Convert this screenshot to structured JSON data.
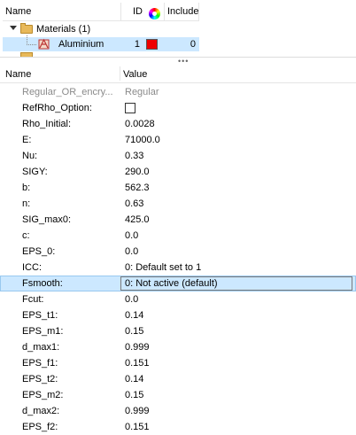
{
  "browser": {
    "columns": {
      "name": "Name",
      "id": "ID",
      "include": "Include"
    },
    "group": {
      "label": "Materials (1)"
    },
    "item": {
      "label": "Aluminium",
      "id": "1",
      "include": "0",
      "color": "#ee0000"
    }
  },
  "editor": {
    "columns": {
      "name": "Name",
      "value": "Value"
    },
    "rows": [
      {
        "name": "Regular_OR_encry...",
        "value": "Regular"
      },
      {
        "name": "RefRho_Option:",
        "value": ""
      },
      {
        "name": "Rho_Initial:",
        "value": "0.0028"
      },
      {
        "name": "E:",
        "value": "71000.0"
      },
      {
        "name": "Nu:",
        "value": "0.33"
      },
      {
        "name": "SIGY:",
        "value": "290.0"
      },
      {
        "name": "b:",
        "value": "562.3"
      },
      {
        "name": "n:",
        "value": "0.63"
      },
      {
        "name": "SIG_max0:",
        "value": "425.0"
      },
      {
        "name": "c:",
        "value": "0.0"
      },
      {
        "name": "EPS_0:",
        "value": "0.0"
      },
      {
        "name": "ICC:",
        "value": "0: Default set to 1"
      },
      {
        "name": "Fsmooth:",
        "value": "0: Not active (default)"
      },
      {
        "name": "Fcut:",
        "value": "0.0"
      },
      {
        "name": "EPS_t1:",
        "value": "0.14"
      },
      {
        "name": "EPS_m1:",
        "value": "0.15"
      },
      {
        "name": "d_max1:",
        "value": "0.999"
      },
      {
        "name": "EPS_f1:",
        "value": "0.151"
      },
      {
        "name": "EPS_t2:",
        "value": "0.14"
      },
      {
        "name": "EPS_m2:",
        "value": "0.15"
      },
      {
        "name": "d_max2:",
        "value": "0.999"
      },
      {
        "name": "EPS_f2:",
        "value": "0.151"
      }
    ]
  },
  "colors": {
    "selection": "#cce8ff",
    "swatch": "#ee0000"
  }
}
